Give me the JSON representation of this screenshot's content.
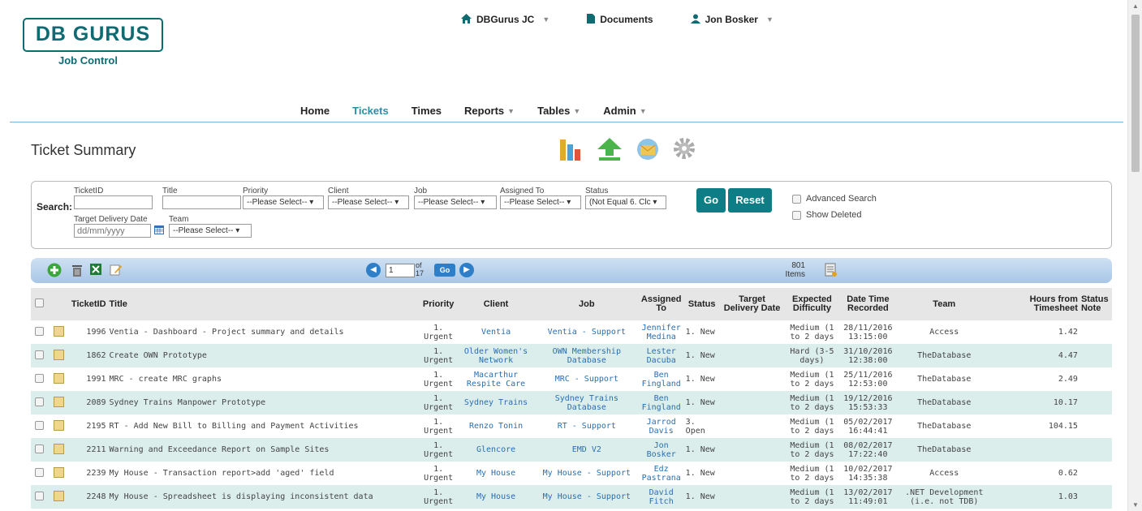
{
  "logo": {
    "name": "DB GURUS",
    "sub": "Job Control"
  },
  "topnav": {
    "org": "DBGurus JC",
    "documents": "Documents",
    "user": "Jon Bosker"
  },
  "mainnav": [
    {
      "label": "Home"
    },
    {
      "label": "Tickets",
      "active": true
    },
    {
      "label": "Times"
    },
    {
      "label": "Reports",
      "caret": true
    },
    {
      "label": "Tables",
      "caret": true
    },
    {
      "label": "Admin",
      "caret": true
    }
  ],
  "page_title": "Ticket Summary",
  "search": {
    "label": "Search:",
    "ticketid_label": "TicketID",
    "title_label": "Title",
    "priority_label": "Priority",
    "client_label": "Client",
    "job_label": "Job",
    "assigned_label": "Assigned To",
    "status_label": "Status",
    "target_label": "Target Delivery Date",
    "team_label": "Team",
    "priority_value": "--Please Select-- ▾",
    "client_value": "--Please Select-- ▾",
    "job_value": "--Please Select-- ▾",
    "assigned_value": "--Please Select-- ▾",
    "status_value": "(Not Equal 6. Clc ▾",
    "team_value": "--Please Select-- ▾",
    "date_placeholder": "dd/mm/yyyy",
    "go": "Go",
    "reset": "Reset",
    "advanced": "Advanced Search",
    "show_deleted": "Show Deleted"
  },
  "pager": {
    "page": "1",
    "of": "of",
    "total": "17",
    "go": "Go",
    "items_count": "801",
    "items_label": "Items"
  },
  "table": {
    "headers": [
      "TicketID",
      "Title",
      "Priority",
      "Client",
      "Job",
      "Assigned To",
      "Status",
      "Target Delivery Date",
      "Expected Difficulty",
      "Date Time Recorded",
      "Team",
      "Hours from Timesheet",
      "Status Note"
    ],
    "rows": [
      {
        "id": "1996",
        "title": "Ventia - Dashboard - Project summary and details",
        "priority": "1. Urgent",
        "client": "Ventia",
        "job": "Ventia - Support",
        "assigned": "Jennifer Medina",
        "status": "1. New",
        "target": "",
        "difficulty": "Medium (1 to 2 days",
        "recorded": "28/11/2016 13:15:00",
        "team": "Access",
        "hours": "1.42",
        "note": ""
      },
      {
        "id": "1862",
        "title": "Create OWN Prototype",
        "priority": "1. Urgent",
        "client": "Older Women's Network",
        "job": "OWN Membership Database",
        "assigned": "Lester Dacuba",
        "status": "1. New",
        "target": "",
        "difficulty": "Hard (3-5 days)",
        "recorded": "31/10/2016 12:38:00",
        "team": "TheDatabase",
        "hours": "4.47",
        "note": ""
      },
      {
        "id": "1991",
        "title": "MRC - create MRC graphs",
        "priority": "1. Urgent",
        "client": "Macarthur Respite Care",
        "job": "MRC - Support",
        "assigned": "Ben Fingland",
        "status": "1. New",
        "target": "",
        "difficulty": "Medium (1 to 2 days",
        "recorded": "25/11/2016 12:53:00",
        "team": "TheDatabase",
        "hours": "2.49",
        "note": ""
      },
      {
        "id": "2089",
        "title": "Sydney Trains Manpower Prototype",
        "priority": "1. Urgent",
        "client": "Sydney Trains",
        "job": "Sydney Trains Database",
        "assigned": "Ben Fingland",
        "status": "1. New",
        "target": "",
        "difficulty": "Medium (1 to 2 days",
        "recorded": "19/12/2016 15:53:33",
        "team": "TheDatabase",
        "hours": "10.17",
        "note": ""
      },
      {
        "id": "2195",
        "title": "RT - Add New Bill to Billing and Payment Activities",
        "priority": "1. Urgent",
        "client": "Renzo Tonin",
        "job": "RT - Support",
        "assigned": "Jarrod Davis",
        "status": "3. Open",
        "target": "",
        "difficulty": "Medium (1 to 2 days",
        "recorded": "05/02/2017 16:44:41",
        "team": "TheDatabase",
        "hours": "104.15",
        "note": ""
      },
      {
        "id": "2211",
        "title": "Warning and Exceedance Report on Sample Sites",
        "priority": "1. Urgent",
        "client": "Glencore",
        "job": "EMD V2",
        "assigned": "Jon Bosker",
        "status": "1. New",
        "target": "",
        "difficulty": "Medium (1 to 2 days",
        "recorded": "08/02/2017 17:22:40",
        "team": "TheDatabase",
        "hours": "",
        "note": ""
      },
      {
        "id": "2239",
        "title": "My House - Transaction report>add 'aged' field",
        "priority": "1. Urgent",
        "client": "My House",
        "job": "My House - Support",
        "assigned": "Edz Pastrana",
        "status": "1. New",
        "target": "",
        "difficulty": "Medium (1 to 2 days",
        "recorded": "10/02/2017 14:35:38",
        "team": "Access",
        "hours": "0.62",
        "note": ""
      },
      {
        "id": "2248",
        "title": "My House - Spreadsheet is displaying inconsistent data",
        "priority": "1. Urgent",
        "client": "My House",
        "job": "My House - Support",
        "assigned": "David Fitch",
        "status": "1. New",
        "target": "",
        "difficulty": "Medium (1 to 2 days",
        "recorded": "13/02/2017 11:49:01",
        "team": ".NET Development (i.e. not TDB)",
        "hours": "1.03",
        "note": ""
      }
    ]
  }
}
